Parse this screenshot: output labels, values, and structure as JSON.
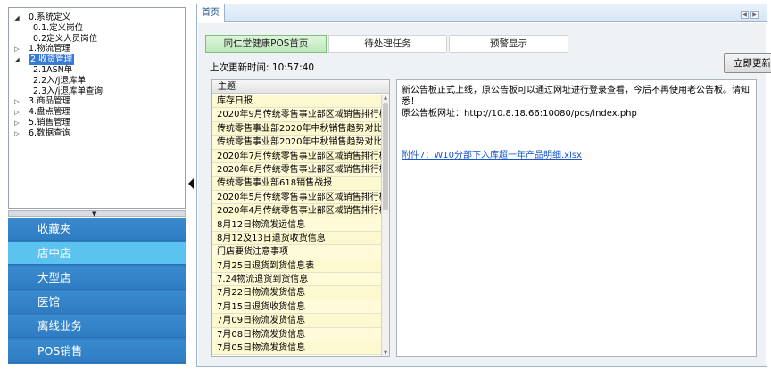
{
  "tree": {
    "items": [
      {
        "label": "0.系统定义",
        "arrow": "◢",
        "level": 0
      },
      {
        "label": "0.1.定义岗位",
        "arrow": "",
        "level": 1
      },
      {
        "label": "0.2定义人员岗位",
        "arrow": "",
        "level": 1
      },
      {
        "label": "1.物流管理",
        "arrow": "▷",
        "level": 0
      },
      {
        "label": "2.收货管理",
        "arrow": "◢",
        "level": 0,
        "selected": true
      },
      {
        "label": "2.1ASN单",
        "arrow": "",
        "level": 1
      },
      {
        "label": "2.2入/j退库单",
        "arrow": "",
        "level": 1
      },
      {
        "label": "2.3入/j退库单查询",
        "arrow": "",
        "level": 1
      },
      {
        "label": "3.商品管理",
        "arrow": "▷",
        "level": 0
      },
      {
        "label": "4.盘点管理",
        "arrow": "▷",
        "level": 0
      },
      {
        "label": "5.销售管理",
        "arrow": "▷",
        "level": 0
      },
      {
        "label": "6.数据查询",
        "arrow": "▷",
        "level": 0
      }
    ]
  },
  "nav": {
    "items": [
      {
        "label": "收藏夹",
        "active": false
      },
      {
        "label": "店中店",
        "active": true
      },
      {
        "label": "大型店",
        "active": false
      },
      {
        "label": "医馆",
        "active": false
      },
      {
        "label": "离线业务",
        "active": false
      },
      {
        "label": "POS销售",
        "active": false
      }
    ]
  },
  "main": {
    "home_tab": "首页",
    "subtabs": [
      {
        "label": "同仁堂健康POS首页",
        "active": true
      },
      {
        "label": "待处理任务",
        "active": false
      },
      {
        "label": "预警显示",
        "active": false
      }
    ],
    "last_update_label": "上次更新时间:",
    "last_update_time": "10:57:40",
    "update_button": "立即更新",
    "list": {
      "header": "主题",
      "rows": [
        "库存日报",
        "2020年9月传统零售事业部区域销售排行榜",
        "传统零售事业部2020年中秋销售趋势对比",
        "传统零售事业部2020年中秋销售趋势对比",
        "2020年7月传统零售事业部区域销售排行榜",
        "2020年6月传统零售事业部区域销售排行榜",
        "传统零售事业部618销售战报",
        "2020年5月传统零售事业部区域销售排行榜",
        "2020年4月传统零售事业部区域销售排行榜",
        "8月12日物流发运信息",
        "8月12及13日退货收货信息",
        "门店要货注意事项",
        "7月25日退货到货信息表",
        "7.24物流退货到货信息",
        "7月22日物流发货信息",
        "7月15日退货收货信息",
        "7月09日物流发货信息",
        "7月08日物流发货信息",
        "7月05日物流发货信息"
      ]
    },
    "notice": {
      "text": "新公告板正式上线，原公告板可以通过网址进行登录查看，今后不再使用老公告板。请知悉！",
      "url_line": "原公告板网址：http://10.8.18.66:10080/pos/index.php",
      "attachment": "附件7：W10分部下入库超一年产品明细.xlsx"
    }
  }
}
